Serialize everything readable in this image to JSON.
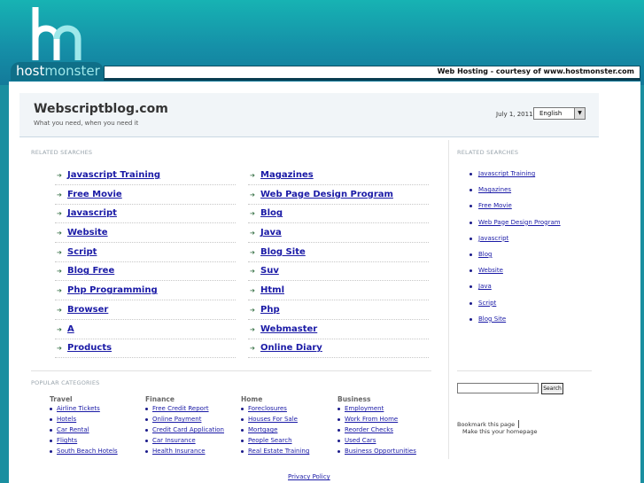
{
  "banner": {
    "logo_host": "host",
    "logo_monster": "monster",
    "courtesy": "Web Hosting - courtesy of www.hostmonster.com"
  },
  "header": {
    "site_title": "Webscriptblog.com",
    "tagline": "What you need, when you need it",
    "date": "July 1, 2011",
    "language": "English"
  },
  "related": {
    "heading": "RELATED SEARCHES",
    "rows": [
      [
        "Javascript Training",
        "Magazines"
      ],
      [
        "Free Movie",
        "Web Page Design Program"
      ],
      [
        "Javascript",
        "Blog"
      ],
      [
        "Website",
        "Java"
      ],
      [
        "Script",
        "Blog Site"
      ],
      [
        "Blog Free",
        "Suv"
      ],
      [
        "Php Programming",
        "Html"
      ],
      [
        "Browser",
        "Php"
      ],
      [
        "A",
        "Webmaster"
      ],
      [
        "Products",
        "Online Diary"
      ]
    ]
  },
  "sidebar": {
    "heading": "RELATED SEARCHES",
    "items": [
      "Javascript Training",
      "Magazines",
      "Free Movie",
      "Web Page Design Program",
      "Javascript",
      "Blog",
      "Website",
      "Java",
      "Script",
      "Blog Site"
    ],
    "search_button": "Search",
    "bookmark": "Bookmark this page",
    "homepage": "Make this your homepage"
  },
  "popular": {
    "heading": "POPULAR CATEGORIES",
    "columns": [
      {
        "title": "Travel",
        "items": [
          "Airline Tickets",
          "Hotels",
          "Car Rental",
          "Flights",
          "South Beach Hotels"
        ]
      },
      {
        "title": "Finance",
        "items": [
          "Free Credit Report",
          "Online Payment",
          "Credit Card Application",
          "Car Insurance",
          "Health Insurance"
        ]
      },
      {
        "title": "Home",
        "items": [
          "Foreclosures",
          "Houses For Sale",
          "Mortgage",
          "People Search",
          "Real Estate Training"
        ]
      },
      {
        "title": "Business",
        "items": [
          "Employment",
          "Work From Home",
          "Reorder Checks",
          "Used Cars",
          "Business Opportunities"
        ]
      }
    ]
  },
  "footer": {
    "privacy": "Privacy Policy"
  },
  "colors": {
    "banner": "#1590a8",
    "link": "#1a1aa6",
    "arrow": "#2f6b3f"
  }
}
